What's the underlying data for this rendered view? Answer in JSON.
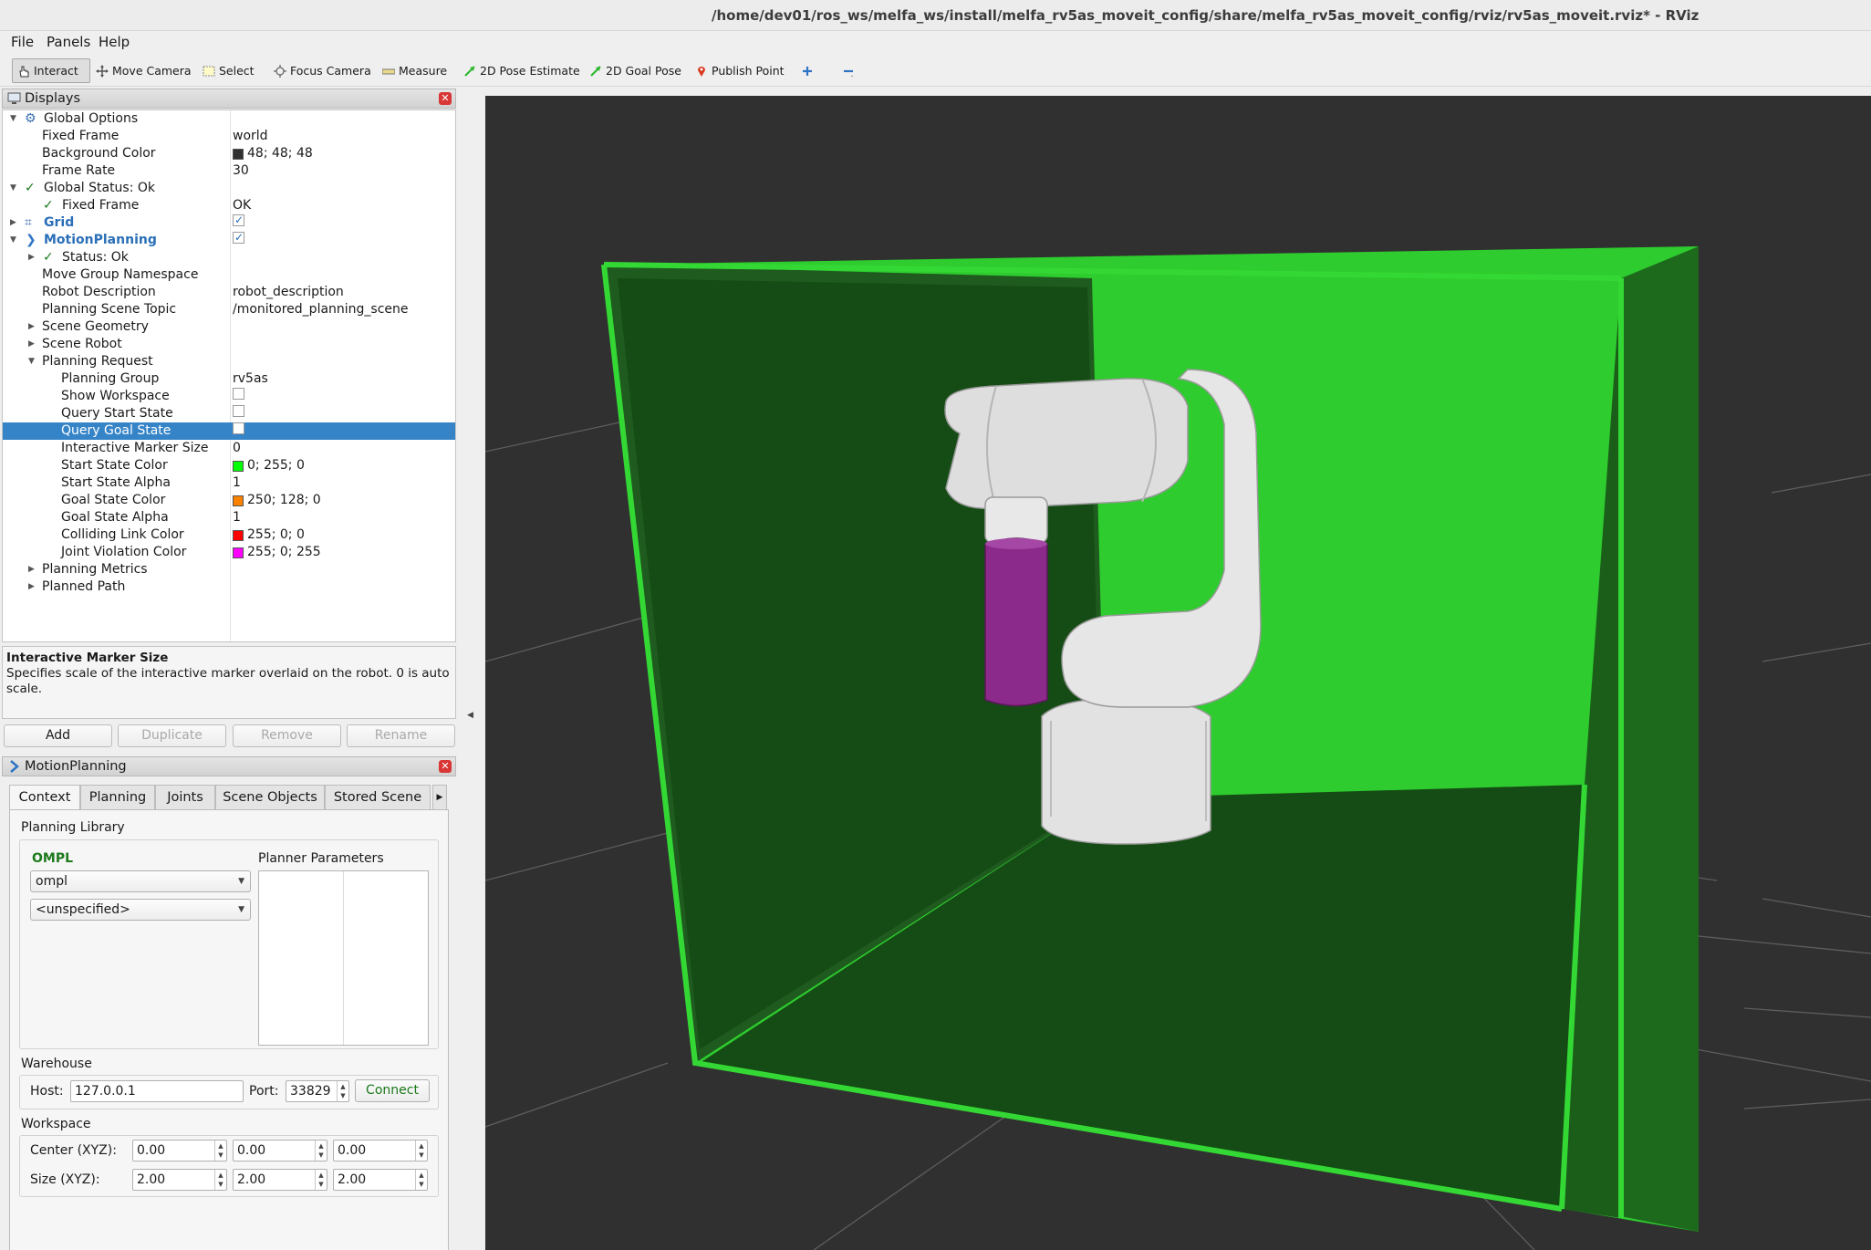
{
  "window": {
    "title": "/home/dev01/ros_ws/melfa_ws/install/melfa_rv5as_moveit_config/share/melfa_rv5as_moveit_config/rviz/rv5as_moveit.rviz* - RViz"
  },
  "menu": {
    "file": "File",
    "panels": "Panels",
    "help": "Help"
  },
  "toolbar": {
    "interact": "Interact",
    "move_camera": "Move Camera",
    "select": "Select",
    "focus_camera": "Focus Camera",
    "measure": "Measure",
    "pose_estimate": "2D Pose Estimate",
    "goal_pose": "2D Goal Pose",
    "publish_point": "Publish Point"
  },
  "displays": {
    "panel_title": "Displays",
    "rows": [
      {
        "label": "Global Options",
        "value": ""
      },
      {
        "label": "Fixed Frame",
        "value": "world"
      },
      {
        "label": "Background Color",
        "value": "48; 48; 48",
        "swatch": "#303030"
      },
      {
        "label": "Frame Rate",
        "value": "30"
      },
      {
        "label": "Global Status: Ok",
        "value": ""
      },
      {
        "label": "Fixed Frame",
        "value": "OK"
      },
      {
        "label": "Grid",
        "value": ""
      },
      {
        "label": "MotionPlanning",
        "value": ""
      },
      {
        "label": "Status: Ok",
        "value": ""
      },
      {
        "label": "Move Group Namespace",
        "value": ""
      },
      {
        "label": "Robot Description",
        "value": "robot_description"
      },
      {
        "label": "Planning Scene Topic",
        "value": "/monitored_planning_scene"
      },
      {
        "label": "Scene Geometry",
        "value": ""
      },
      {
        "label": "Scene Robot",
        "value": ""
      },
      {
        "label": "Planning Request",
        "value": ""
      },
      {
        "label": "Planning Group",
        "value": "rv5as"
      },
      {
        "label": "Show Workspace",
        "value": ""
      },
      {
        "label": "Query Start State",
        "value": ""
      },
      {
        "label": "Query Goal State",
        "value": ""
      },
      {
        "label": "Interactive Marker Size",
        "value": "0"
      },
      {
        "label": "Start State Color",
        "value": "0; 255; 0",
        "swatch": "#00ff00"
      },
      {
        "label": "Start State Alpha",
        "value": "1"
      },
      {
        "label": "Goal State Color",
        "value": "250; 128; 0",
        "swatch": "#fa8000"
      },
      {
        "label": "Goal State Alpha",
        "value": "1"
      },
      {
        "label": "Colliding Link Color",
        "value": "255; 0; 0",
        "swatch": "#ff0000"
      },
      {
        "label": "Joint Violation Color",
        "value": "255; 0; 255",
        "swatch": "#ff00ff"
      },
      {
        "label": "Planning Metrics",
        "value": ""
      },
      {
        "label": "Planned Path",
        "value": ""
      }
    ],
    "description_title": "Interactive Marker Size",
    "description_text": "Specifies scale of the interactive marker overlaid on the robot. 0 is auto scale.",
    "buttons": {
      "add": "Add",
      "duplicate": "Duplicate",
      "remove": "Remove",
      "rename": "Rename"
    }
  },
  "motion_planning": {
    "panel_title": "MotionPlanning",
    "tabs": [
      "Context",
      "Planning",
      "Joints",
      "Scene Objects",
      "Stored Scene"
    ],
    "planning_library_label": "Planning Library",
    "ompl_label": "OMPL",
    "planner_parameters_label": "Planner Parameters",
    "library_value": "ompl",
    "planner_value": "<unspecified>",
    "warehouse_label": "Warehouse",
    "host_label": "Host:",
    "host_value": "127.0.0.1",
    "port_label": "Port:",
    "port_value": "33829",
    "connect_label": "Connect",
    "workspace_label": "Workspace",
    "center_label": "Center (XYZ):",
    "center_values": [
      "0.00",
      "0.00",
      "0.00"
    ],
    "size_label": "Size (XYZ):",
    "size_values": [
      "2.00",
      "2.00",
      "2.00"
    ]
  },
  "colors": {
    "accent_selection": "#3584c8",
    "viewport_bg": "#303030",
    "box_green": "#2ecc2e",
    "box_green_dark": "#134f13"
  }
}
